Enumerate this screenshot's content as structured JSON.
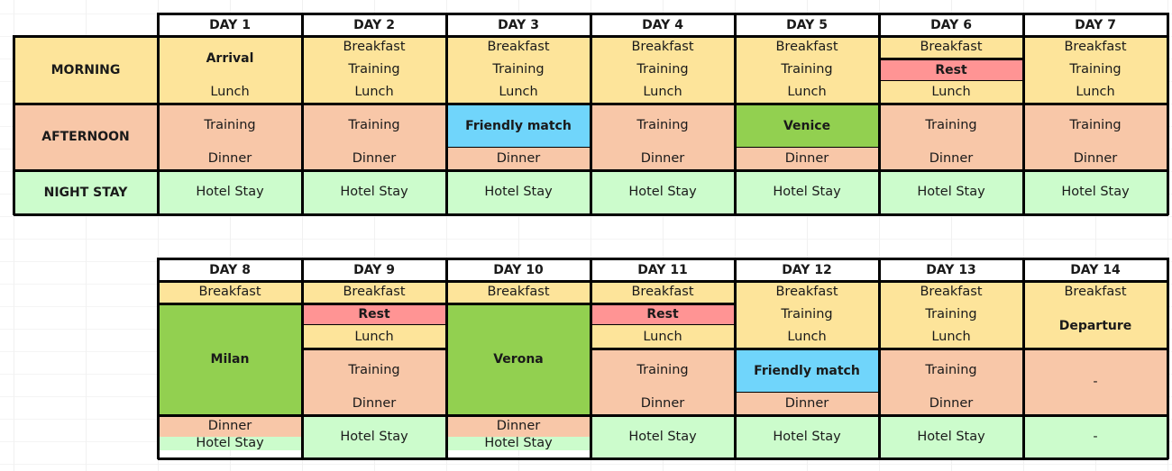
{
  "colors": {
    "morning": "#fde49a",
    "afternoon": "#f8c7a8",
    "night": "#ccfccc",
    "rest": "#ff9494",
    "friendly_match": "#70d5fb",
    "city_trip": "#92d050",
    "header": "#ffffff",
    "border": "#000000"
  },
  "row_labels": {
    "morning": "MORNING",
    "afternoon": "AFTERNOON",
    "night": "NIGHT STAY"
  },
  "week1": {
    "days": [
      {
        "label": "DAY 1",
        "cells": [
          {
            "text": "Arrival",
            "type": "morning",
            "bold": true,
            "span": 2
          },
          {
            "text": "Lunch",
            "type": "morning",
            "span": 1
          },
          {
            "text": "Training",
            "type": "afternoon",
            "span": 2
          },
          {
            "text": "Dinner",
            "type": "afternoon",
            "span": 1
          },
          {
            "text": "Hotel Stay",
            "type": "night",
            "span": 2
          }
        ]
      },
      {
        "label": "DAY 2",
        "cells": [
          {
            "text": "Breakfast",
            "type": "morning",
            "span": 1
          },
          {
            "text": "Training",
            "type": "morning",
            "span": 1
          },
          {
            "text": "Lunch",
            "type": "morning",
            "span": 1
          },
          {
            "text": "Training",
            "type": "afternoon",
            "span": 2
          },
          {
            "text": "Dinner",
            "type": "afternoon",
            "span": 1
          },
          {
            "text": "Hotel Stay",
            "type": "night",
            "span": 2
          }
        ]
      },
      {
        "label": "DAY 3",
        "cells": [
          {
            "text": "Breakfast",
            "type": "morning",
            "span": 1
          },
          {
            "text": "Training",
            "type": "morning",
            "span": 1
          },
          {
            "text": "Lunch",
            "type": "morning",
            "span": 1
          },
          {
            "text": "Friendly match",
            "type": "match",
            "bold": true,
            "span": 2,
            "boxed": true
          },
          {
            "text": "Dinner",
            "type": "afternoon",
            "span": 1
          },
          {
            "text": "Hotel Stay",
            "type": "night",
            "span": 2
          }
        ]
      },
      {
        "label": "DAY 4",
        "cells": [
          {
            "text": "Breakfast",
            "type": "morning",
            "span": 1
          },
          {
            "text": "Training",
            "type": "morning",
            "span": 1
          },
          {
            "text": "Lunch",
            "type": "morning",
            "span": 1
          },
          {
            "text": "Training",
            "type": "afternoon",
            "span": 2
          },
          {
            "text": "Dinner",
            "type": "afternoon",
            "span": 1
          },
          {
            "text": "Hotel Stay",
            "type": "night",
            "span": 2
          }
        ]
      },
      {
        "label": "DAY 5",
        "cells": [
          {
            "text": "Breakfast",
            "type": "morning",
            "span": 1
          },
          {
            "text": "Training",
            "type": "morning",
            "span": 1
          },
          {
            "text": "Lunch",
            "type": "morning",
            "span": 1
          },
          {
            "text": "Venice",
            "type": "city",
            "bold": true,
            "span": 2,
            "boxed": true
          },
          {
            "text": "Dinner",
            "type": "afternoon",
            "span": 1
          },
          {
            "text": "Hotel Stay",
            "type": "night",
            "span": 2
          }
        ]
      },
      {
        "label": "DAY 6",
        "cells": [
          {
            "text": "Breakfast",
            "type": "morning",
            "span": 1
          },
          {
            "text": "Rest",
            "type": "rest",
            "bold": true,
            "span": 1,
            "boxed": true
          },
          {
            "text": "Lunch",
            "type": "morning",
            "span": 1
          },
          {
            "text": "Training",
            "type": "afternoon",
            "span": 2
          },
          {
            "text": "Dinner",
            "type": "afternoon",
            "span": 1
          },
          {
            "text": "Hotel Stay",
            "type": "night",
            "span": 2
          }
        ]
      },
      {
        "label": "DAY 7",
        "cells": [
          {
            "text": "Breakfast",
            "type": "morning",
            "span": 1
          },
          {
            "text": "Training",
            "type": "morning",
            "span": 1
          },
          {
            "text": "Lunch",
            "type": "morning",
            "span": 1
          },
          {
            "text": "Training",
            "type": "afternoon",
            "span": 2
          },
          {
            "text": "Dinner",
            "type": "afternoon",
            "span": 1
          },
          {
            "text": "Hotel Stay",
            "type": "night",
            "span": 2
          }
        ]
      }
    ]
  },
  "week2": {
    "days": [
      {
        "label": "DAY 8",
        "cells": [
          {
            "text": "Breakfast",
            "type": "morning",
            "span": 1,
            "boxed": true
          },
          {
            "text": "Milan",
            "type": "city",
            "bold": true,
            "span": 5,
            "boxed": true
          },
          {
            "text": "Dinner",
            "type": "afternoon",
            "span": 1
          },
          {
            "text": "Hotel Stay",
            "type": "night",
            "span": 2
          }
        ]
      },
      {
        "label": "DAY 9",
        "cells": [
          {
            "text": "Breakfast",
            "type": "morning",
            "span": 1
          },
          {
            "text": "Rest",
            "type": "rest",
            "bold": true,
            "span": 1,
            "boxed": true
          },
          {
            "text": "Lunch",
            "type": "morning",
            "span": 1
          },
          {
            "text": "Training",
            "type": "afternoon",
            "span": 2,
            "boxtop": true
          },
          {
            "text": "Dinner",
            "type": "afternoon",
            "span": 1
          },
          {
            "text": "Hotel Stay",
            "type": "night",
            "span": 2
          }
        ]
      },
      {
        "label": "DAY 10",
        "cells": [
          {
            "text": "Breakfast",
            "type": "morning",
            "span": 1,
            "boxed": true
          },
          {
            "text": "Verona",
            "type": "city",
            "bold": true,
            "span": 5,
            "boxed": true
          },
          {
            "text": "Dinner",
            "type": "afternoon",
            "span": 1
          },
          {
            "text": "Hotel Stay",
            "type": "night",
            "span": 2
          }
        ]
      },
      {
        "label": "DAY 11",
        "cells": [
          {
            "text": "Breakfast",
            "type": "morning",
            "span": 1
          },
          {
            "text": "Rest",
            "type": "rest",
            "bold": true,
            "span": 1,
            "boxed": true
          },
          {
            "text": "Lunch",
            "type": "morning",
            "span": 1
          },
          {
            "text": "Training",
            "type": "afternoon",
            "span": 2,
            "boxtop": true
          },
          {
            "text": "Dinner",
            "type": "afternoon",
            "span": 1
          },
          {
            "text": "Hotel Stay",
            "type": "night",
            "span": 2
          }
        ]
      },
      {
        "label": "DAY 12",
        "cells": [
          {
            "text": "Breakfast",
            "type": "morning",
            "span": 1
          },
          {
            "text": "Training",
            "type": "morning",
            "span": 1
          },
          {
            "text": "Lunch",
            "type": "morning",
            "span": 1
          },
          {
            "text": "Friendly match",
            "type": "match",
            "bold": true,
            "span": 2,
            "boxed": true
          },
          {
            "text": "Dinner",
            "type": "afternoon",
            "span": 1
          },
          {
            "text": "Hotel Stay",
            "type": "night",
            "span": 2
          }
        ]
      },
      {
        "label": "DAY 13",
        "cells": [
          {
            "text": "Breakfast",
            "type": "morning",
            "span": 1
          },
          {
            "text": "Training",
            "type": "morning",
            "span": 1
          },
          {
            "text": "Lunch",
            "type": "morning",
            "span": 1
          },
          {
            "text": "Training",
            "type": "afternoon",
            "span": 2,
            "boxtop": true
          },
          {
            "text": "Dinner",
            "type": "afternoon",
            "span": 1
          },
          {
            "text": "Hotel Stay",
            "type": "night",
            "span": 2
          }
        ]
      },
      {
        "label": "DAY 14",
        "cells": [
          {
            "text": "Breakfast",
            "type": "morning",
            "span": 1
          },
          {
            "text": "Departure",
            "type": "morning",
            "bold": true,
            "span": 2
          },
          {
            "text": "-",
            "type": "afternoon",
            "span": 3,
            "boxtop": true
          },
          {
            "text": "-",
            "type": "night",
            "span": 2
          }
        ]
      }
    ]
  }
}
